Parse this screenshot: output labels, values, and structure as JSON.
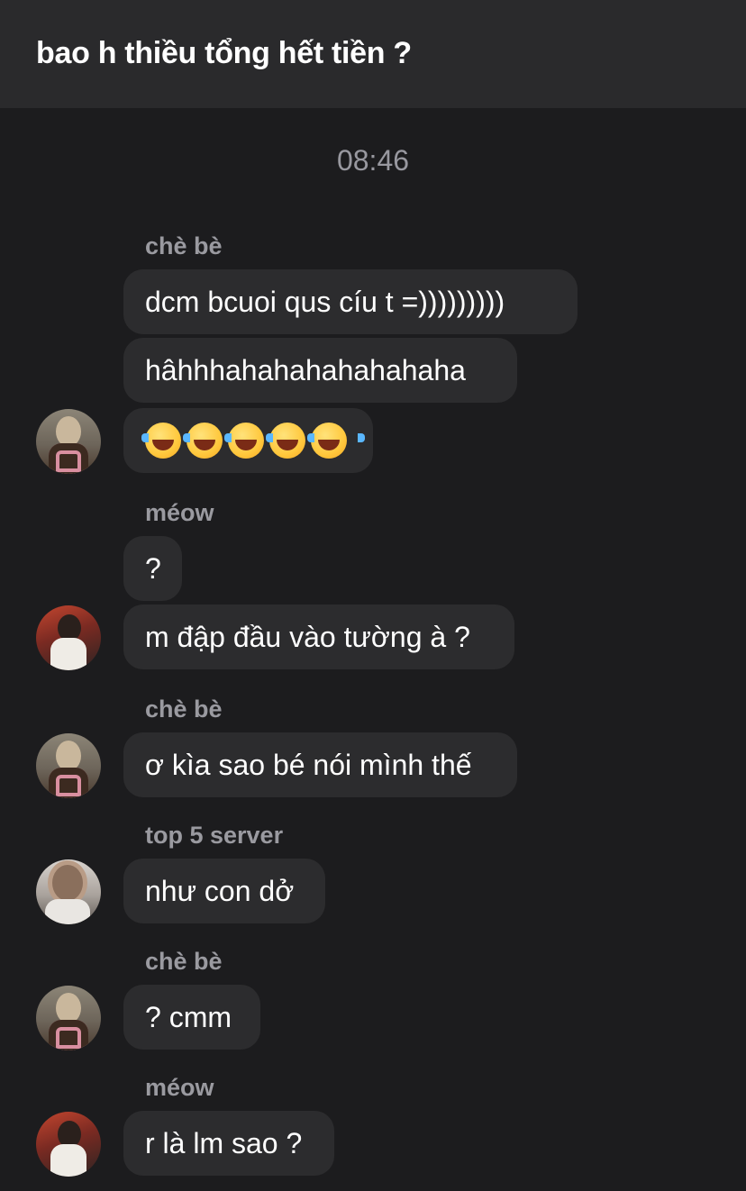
{
  "header": {
    "title": "bao h thiều tổng hết tiền ?"
  },
  "timestamp": "08:46",
  "groups": [
    {
      "sender": "chè bè",
      "messages": [
        "dcm bcuoi qus cíu t =)))))))))",
        "hâhhhahahahahahahaha"
      ],
      "emoji_message": {
        "icon": "face-with-tears-of-joy",
        "count": 5
      }
    },
    {
      "sender": "méow",
      "messages": [
        "?",
        "m đập đầu vào tường à ?"
      ]
    },
    {
      "sender": "chè bè",
      "messages": [
        "ơ kìa sao bé nói mình thế"
      ]
    },
    {
      "sender": "top 5 server",
      "messages": [
        "như con dở"
      ]
    },
    {
      "sender": "chè bè",
      "messages": [
        "? cmm"
      ]
    },
    {
      "sender": "méow",
      "messages": [
        "r là lm sao ?"
      ]
    }
  ]
}
